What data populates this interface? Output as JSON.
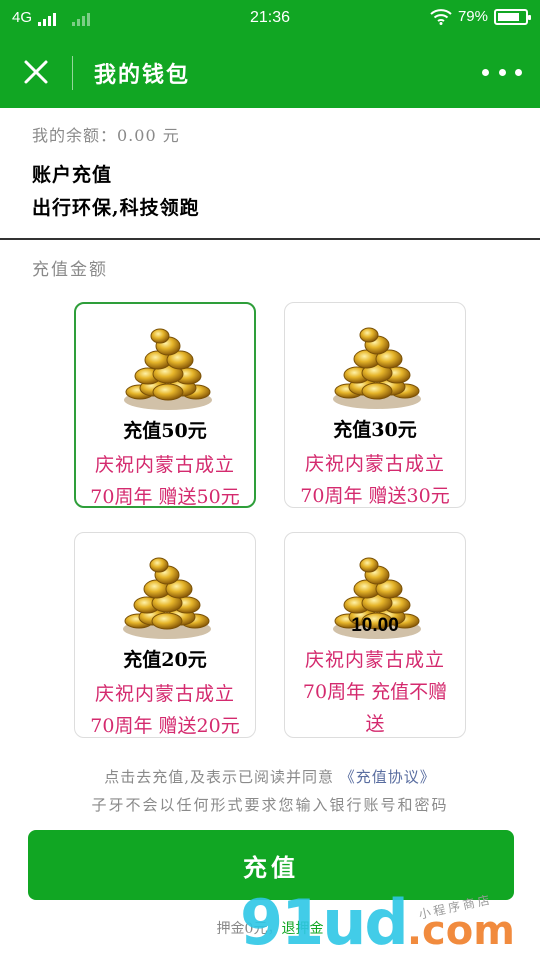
{
  "status_bar": {
    "network": "4G",
    "time": "21:36",
    "battery_percent": "79%",
    "battery_level": 0.79,
    "color": "#11a623"
  },
  "nav": {
    "title": "我的钱包",
    "close_icon": "close-icon",
    "more_icon": "more-dots-icon"
  },
  "wallet": {
    "balance_text": "我的余额：0.00 元",
    "recharge_heading": "账户充值",
    "slogan": "出行环保,科技领跑",
    "amount_label": "充值金额"
  },
  "options": [
    {
      "amount": "充值50元",
      "promo_line1": "庆祝内蒙古成立",
      "promo_line2": "70周年 赠送50元",
      "selected": true
    },
    {
      "amount": "充值30元",
      "promo_line1": "庆祝内蒙古成立",
      "promo_line2": "70周年 赠送30元",
      "selected": false
    },
    {
      "amount": "充值20元",
      "promo_line1": "庆祝内蒙古成立",
      "promo_line2": "70周年 赠送20元",
      "selected": false
    },
    {
      "overlay_number": "10.00",
      "promo_line1": "庆祝内蒙古成立",
      "promo_line2": "70周年 充值不赠",
      "promo_line3": "送",
      "selected": false
    }
  ],
  "notice": {
    "prefix": "点击去充值,及表示已阅读并同意",
    "link": "《充值协议》",
    "line2": "子牙不会以任何形式要求您输入银行账号和密码"
  },
  "recharge_button": "充值",
  "footer": {
    "deposit": "押金0元，",
    "refund_link": "退押金"
  },
  "watermark": {
    "brand": "91ud",
    "domain": ".com",
    "sub": "小程序商店"
  },
  "colors": {
    "brand_green": "#11a623",
    "promo_pink": "#d42a6e",
    "selected_border": "#2e9e3a"
  }
}
